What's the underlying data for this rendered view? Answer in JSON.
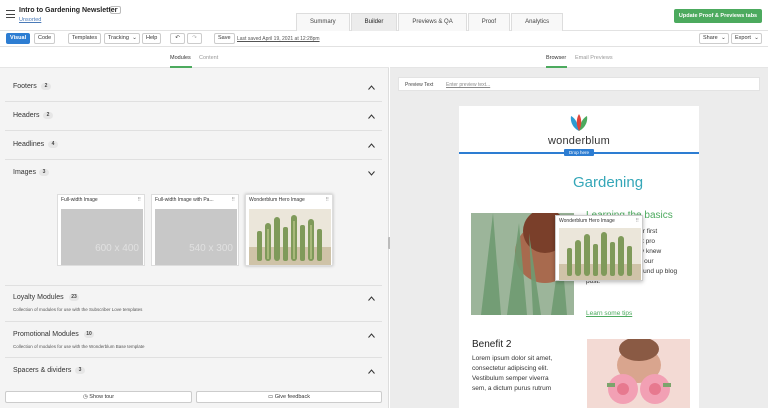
{
  "header": {
    "title": "Intro to Gardening Newsletter",
    "more_label": "···",
    "status": "Unsorted",
    "tabs": [
      "Summary",
      "Builder",
      "Previews & QA",
      "Proof",
      "Analytics"
    ],
    "active_tab": "Builder",
    "update_button": "Update Proof & Previews tabs"
  },
  "toolbar": {
    "visual": "Visual",
    "code": "Code",
    "templates": "Templates",
    "tracking": "Tracking",
    "help": "Help",
    "save": "Save",
    "last_saved": "Last saved April 19, 2021 at 12:28pm",
    "share": "Share",
    "export": "Export"
  },
  "left_panel": {
    "tabs": [
      "Modules",
      "Content"
    ],
    "sections": [
      {
        "title": "Footers",
        "count": "2",
        "expanded": false
      },
      {
        "title": "Headers",
        "count": "2",
        "expanded": false
      },
      {
        "title": "Headlines",
        "count": "4",
        "expanded": false
      },
      {
        "title": "Images",
        "count": "3",
        "expanded": true
      },
      {
        "title": "Loyalty Modules",
        "count": "23",
        "expanded": false,
        "desc": "Collection of modules for use with the Subscriber Love templates"
      },
      {
        "title": "Promotional Modules",
        "count": "10",
        "expanded": false,
        "desc": "Collection of modules for use with the Wonderblum Base template"
      },
      {
        "title": "Spacers & dividers",
        "count": "3",
        "expanded": false
      }
    ],
    "image_cards": [
      {
        "title": "Full-width Image",
        "placeholder": "600 x 400"
      },
      {
        "title": "Full-width Image with Pa...",
        "placeholder": "540 x 300"
      },
      {
        "title": "Wonderblum Hero Image",
        "placeholder": ""
      }
    ],
    "show_tour": "Show tour",
    "give_feedback": "Give feedback"
  },
  "right_panel": {
    "tabs": [
      "Browser",
      "Email Previews"
    ],
    "preview_label": "Preview Text",
    "preview_placeholder": "Enter preview text...",
    "drag_ghost_title": "Wonderblum Hero Image",
    "drop_here": "Drop here",
    "email": {
      "brand": "wonderblum",
      "heading": "Gardening",
      "subheading": "Learning the basics",
      "body_lines": [
        "Looking to start your first",
        "garden? Learn what pro",
        "gardeners wish they knew",
        "when starting out in our",
        "gardening advice round up blog",
        "post."
      ],
      "link": "Learn some tips",
      "benefit_title": "Benefit 2",
      "benefit_lines": [
        "Lorem ipsum dolor sit amet,",
        "consectetur adipiscing elit.",
        "Vestibulum semper viverra",
        "sem, a dictum purus rutrum"
      ]
    }
  },
  "colors": {
    "accent_blue": "#2d7dd2",
    "brand_green": "#4caa5e",
    "teal": "#35a7b8"
  }
}
